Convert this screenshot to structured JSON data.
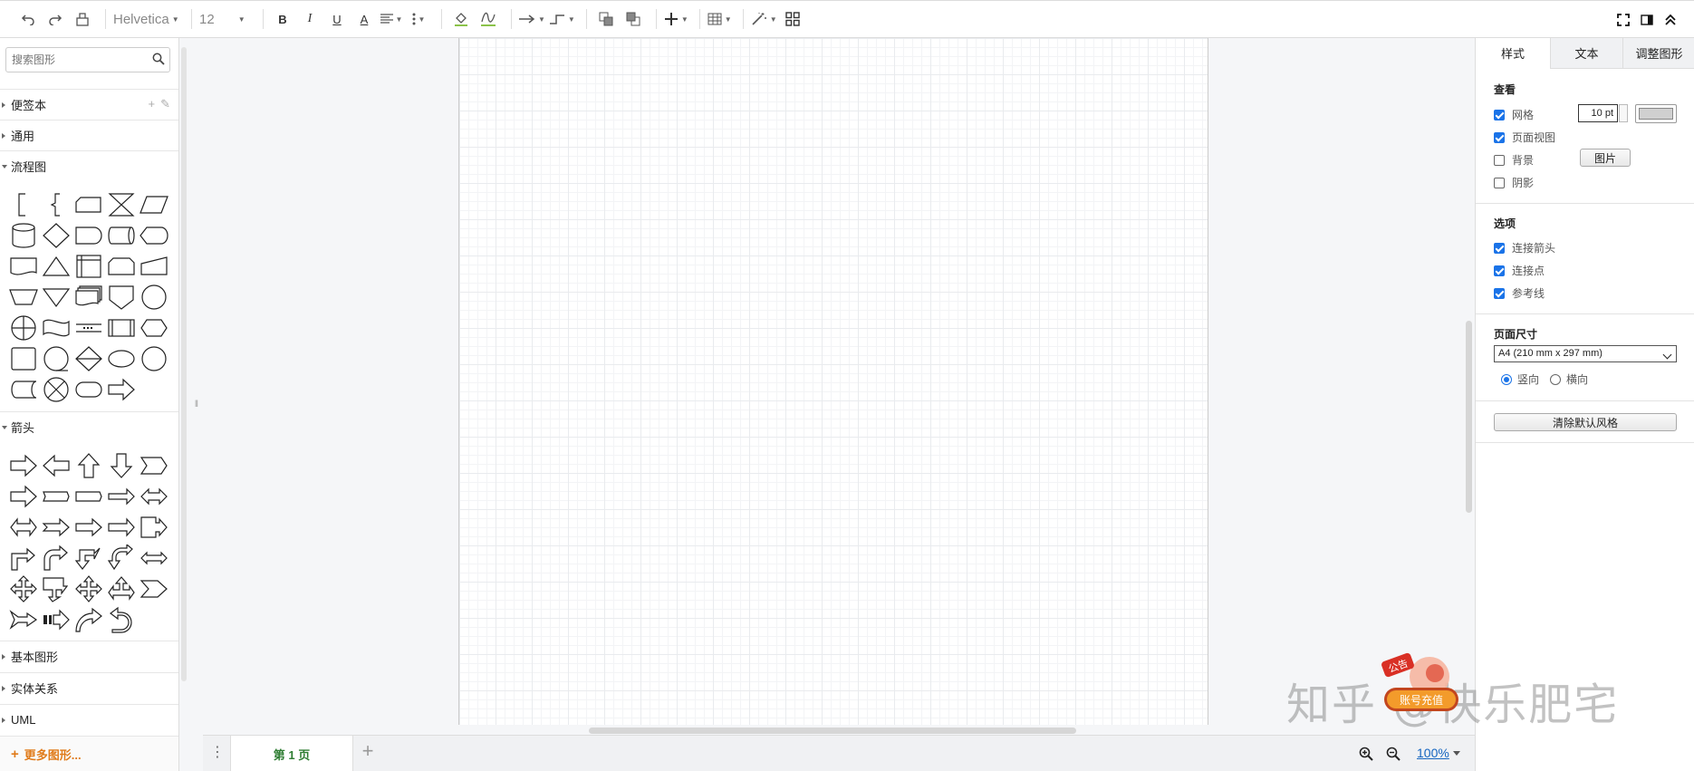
{
  "toolbar": {
    "font_name": "Helvetica",
    "font_size": "12",
    "bold": "B",
    "italic": "I",
    "underline": "U",
    "font_color": "A"
  },
  "sidebar": {
    "search_placeholder": "搜索图形",
    "sections": [
      {
        "label": "便签本",
        "open": false
      },
      {
        "label": "通用",
        "open": false
      },
      {
        "label": "流程图",
        "open": true
      },
      {
        "label": "箭头",
        "open": true
      },
      {
        "label": "基本图形",
        "open": false
      },
      {
        "label": "实体关系",
        "open": false
      },
      {
        "label": "UML",
        "open": false
      }
    ],
    "more_shapes": "更多图形..."
  },
  "bottombar": {
    "page_tab": "第 1 页",
    "zoom": "100%"
  },
  "rightpanel": {
    "tabs": [
      "样式",
      "文本",
      "调整图形"
    ],
    "view_title": "查看",
    "grid_label": "网格",
    "grid_size": "10 pt",
    "page_view_label": "页面视图",
    "background_label": "背景",
    "image_button": "图片",
    "shadow_label": "阴影",
    "options_title": "选项",
    "connect_arrows_label": "连接箭头",
    "connection_points_label": "连接点",
    "guides_label": "参考线",
    "page_size_title": "页面尺寸",
    "page_size_value": "A4 (210 mm x 297 mm)",
    "portrait_label": "竖向",
    "landscape_label": "横向",
    "reset_style_button": "清除默认风格",
    "grid_checked": true,
    "page_view_checked": true,
    "background_checked": false,
    "shadow_checked": false,
    "connect_arrows_checked": true,
    "connection_points_checked": true,
    "guides_checked": true
  },
  "watermark": "知乎 @快乐肥宅",
  "ad_badge_text": "账号充值",
  "ad_badge_tag": "公告",
  "colors": {
    "accent": "#1a73e8",
    "more_shapes": "#e07b1a",
    "page_tab": "#2e7d32",
    "zoom_link": "#1565c0"
  }
}
